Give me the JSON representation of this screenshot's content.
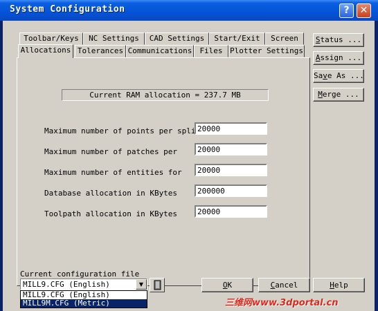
{
  "window": {
    "title": "System Configuration",
    "help_label": "?",
    "close_label": "✕"
  },
  "tabs": {
    "row1": [
      "Toolbar/Keys",
      "NC Settings",
      "CAD Settings",
      "Start/Exit",
      "Screen"
    ],
    "row2": [
      "Allocations",
      "Tolerances",
      "Communications",
      "Files",
      "Plotter Settings"
    ],
    "active": "Allocations"
  },
  "allocations": {
    "ram_text": "Current RAM allocation = 237.7 MB",
    "params": [
      {
        "label": "Maximum number of points per spline",
        "value": "20000"
      },
      {
        "label": "Maximum number of patches per",
        "value": "20000"
      },
      {
        "label": "Maximum number of entities for",
        "value": "20000"
      },
      {
        "label": "Database allocation in KBytes",
        "value": "200000"
      },
      {
        "label": "Toolpath allocation in KBytes",
        "value": "20000"
      }
    ]
  },
  "side_buttons": {
    "status": {
      "prefix": "",
      "key": "S",
      "rest": "tatus ..."
    },
    "assign": {
      "prefix": "",
      "key": "A",
      "rest": "ssign ..."
    },
    "save_as": {
      "prefix": "Sa",
      "key": "v",
      "rest": "e As ..."
    },
    "merge": {
      "prefix": "",
      "key": "M",
      "rest": "erge ..."
    }
  },
  "config": {
    "label": "Current configuration file",
    "selected": "MILL9.CFG (English)",
    "options": [
      "MILL9.CFG (English)",
      "MILL9M.CFG (Metric)"
    ]
  },
  "bottom_buttons": {
    "ok": {
      "key": "O",
      "rest": "K"
    },
    "cancel": {
      "key": "C",
      "rest": "ancel"
    },
    "help": {
      "key": "H",
      "rest": "elp"
    }
  },
  "watermark": "三维网www.3dportal.cn",
  "icons": {
    "help": "help-icon",
    "close": "close-icon",
    "combo": "chevron-down-icon",
    "browse": "book-icon"
  }
}
